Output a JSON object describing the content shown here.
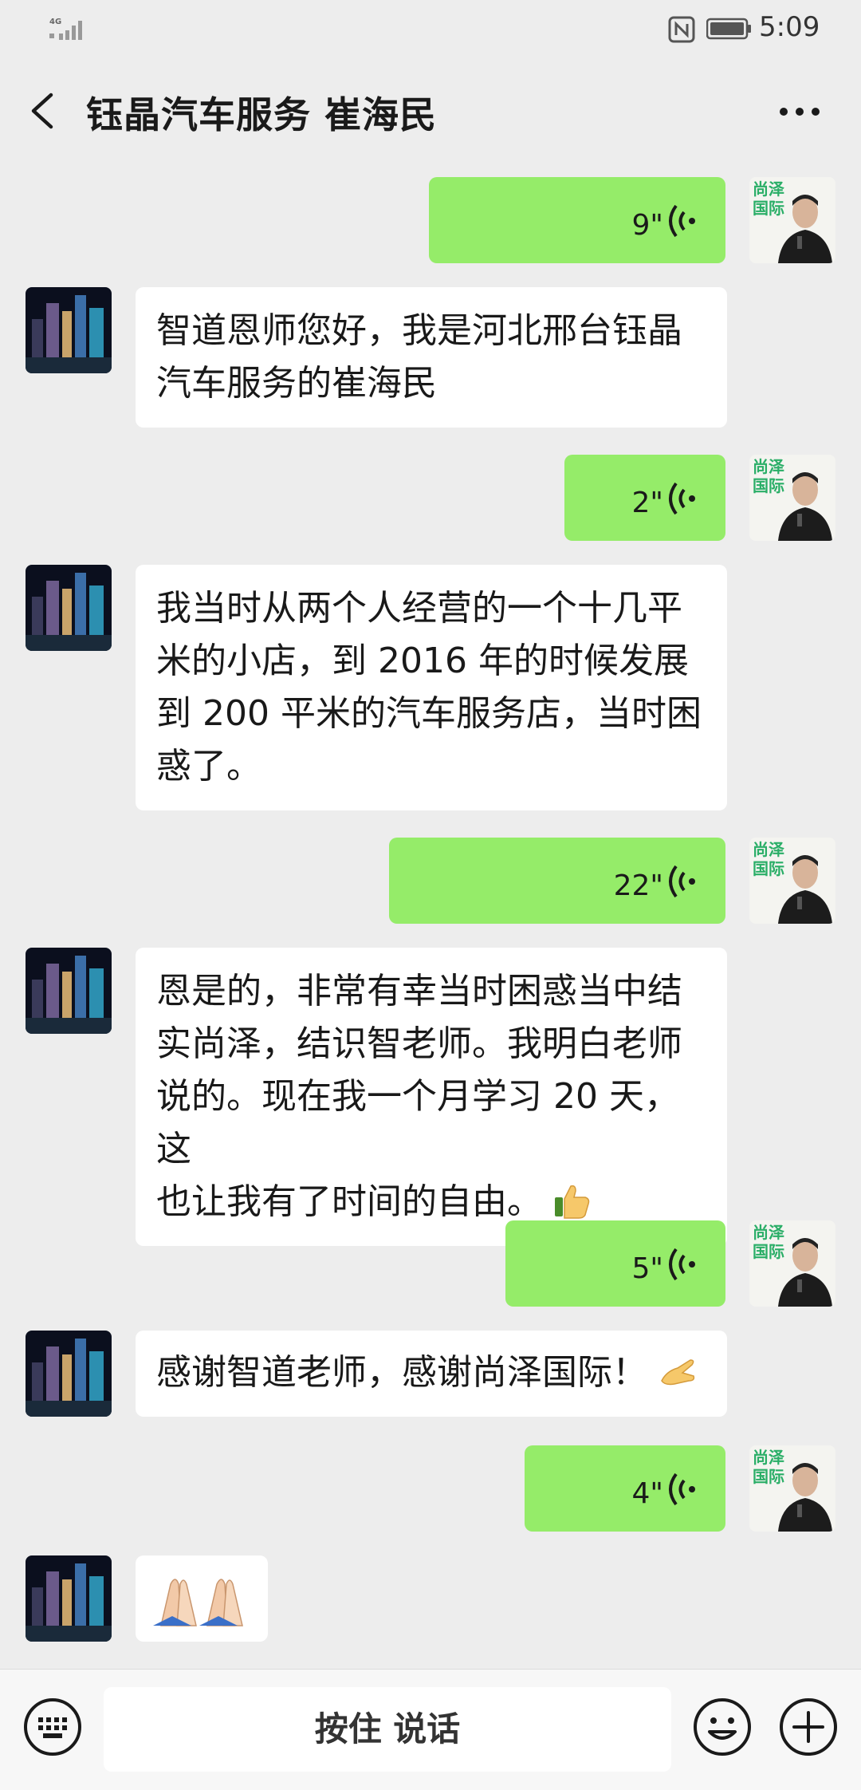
{
  "status_bar": {
    "network": "4G",
    "time": "5:09"
  },
  "header": {
    "title": "钰晶汽车服务 崔海民",
    "back_icon": "chevron-left-icon",
    "more_icon": "more-dots-icon"
  },
  "messages": [
    {
      "side": "out",
      "type": "voice",
      "duration": "9\""
    },
    {
      "side": "in",
      "type": "text",
      "lines": [
        "智道恩师您好，我是河北邢台钰晶",
        "汽车服务的崔海民"
      ]
    },
    {
      "side": "out",
      "type": "voice",
      "duration": "2\""
    },
    {
      "side": "in",
      "type": "text",
      "lines": [
        "我当时从两个人经营的一个十几平",
        "米的小店，到 2016 年的时候发展",
        "到 200 平米的汽车服务店，当时困",
        "惑了。"
      ]
    },
    {
      "side": "out",
      "type": "voice",
      "duration": "22\""
    },
    {
      "side": "in",
      "type": "text",
      "lines": [
        "恩是的，非常有幸当时困惑当中结",
        "实尚泽，结识智老师。我明白老师",
        "说的。现在我一个月学习 20 天，这",
        "也让我有了时间的自由。"
      ],
      "emoji": "thumbs-up-icon"
    },
    {
      "side": "out",
      "type": "voice",
      "duration": "5\""
    },
    {
      "side": "in",
      "type": "text",
      "lines": [
        "感谢智道老师，感谢尚泽国际！"
      ],
      "emoji": "ok-hand-icon"
    },
    {
      "side": "out",
      "type": "voice",
      "duration": "4\""
    },
    {
      "side": "in",
      "type": "emoji",
      "emoji": "praying-hands-icon"
    }
  ],
  "self_avatar_text": "尚泽国际",
  "input_bar": {
    "hold_to_talk": "按住 说话",
    "keyboard_icon": "keyboard-icon",
    "emoji_icon": "smiley-icon",
    "plus_icon": "plus-circle-icon"
  },
  "colors": {
    "out_bubble": "#95ec69",
    "in_bubble": "#ffffff",
    "background": "#ededed",
    "brand_green": "#2aae67"
  }
}
